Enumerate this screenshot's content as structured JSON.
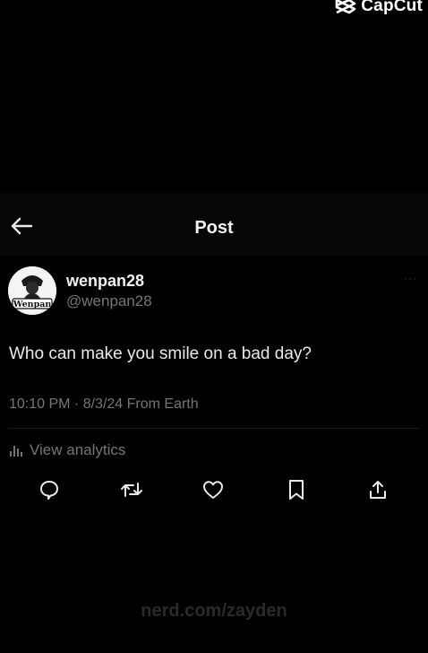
{
  "watermark": {
    "label": "CapCut",
    "icon": "capcut-logo-icon"
  },
  "header": {
    "back_icon": "arrow-left-icon",
    "title": "Post"
  },
  "post": {
    "author": {
      "display_name": "wenpan28",
      "handle": "@wenpan28",
      "avatar_label": "Wenpan"
    },
    "more_icon": "more-options-icon",
    "more_label": "···",
    "text": "Who can make you smile on a bad day?",
    "meta": "10:10 PM · 8/3/24 From Earth",
    "analytics_label": "View analytics",
    "analytics_icon": "bar-chart-icon",
    "actions": [
      {
        "name": "reply",
        "icon": "comment-icon"
      },
      {
        "name": "repost",
        "icon": "repost-icon"
      },
      {
        "name": "like",
        "icon": "heart-icon"
      },
      {
        "name": "bookmark",
        "icon": "bookmark-icon"
      },
      {
        "name": "share",
        "icon": "share-icon"
      }
    ]
  },
  "footer": {
    "credit": "nerd.com/zayden"
  },
  "colors": {
    "background": "#000000",
    "header_bg": "#070707",
    "primary_text": "#e7e9ea",
    "secondary_text": "#71767b"
  }
}
